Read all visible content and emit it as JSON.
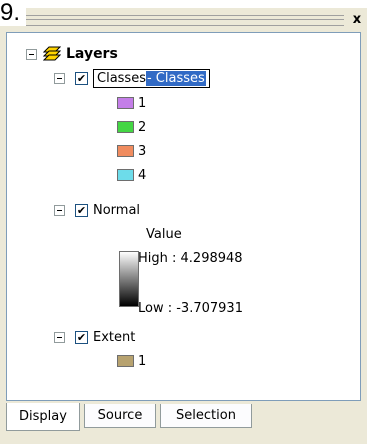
{
  "step_label": "9.",
  "toc": {
    "root": {
      "label": "Layers"
    },
    "layers": [
      {
        "name": "Classes",
        "edit_prefix": "Classes",
        "edit_selected": " - Classes",
        "checked": true,
        "legend": [
          {
            "label": "1",
            "color": "#c47ee8"
          },
          {
            "label": "2",
            "color": "#44d644"
          },
          {
            "label": "3",
            "color": "#f08c5f"
          },
          {
            "label": "4",
            "color": "#6ddcea"
          }
        ]
      },
      {
        "name": "Normal",
        "checked": true,
        "value_heading": "Value",
        "high_label": "High : 4.298948",
        "low_label": "Low : -3.707931"
      },
      {
        "name": "Extent",
        "checked": true,
        "legend": [
          {
            "label": "1",
            "color": "#b7a26f"
          }
        ]
      }
    ]
  },
  "tabs": [
    {
      "label": "Display",
      "active": true
    },
    {
      "label": "Source",
      "active": false
    },
    {
      "label": "Selection",
      "active": false
    }
  ],
  "close_label": "x"
}
